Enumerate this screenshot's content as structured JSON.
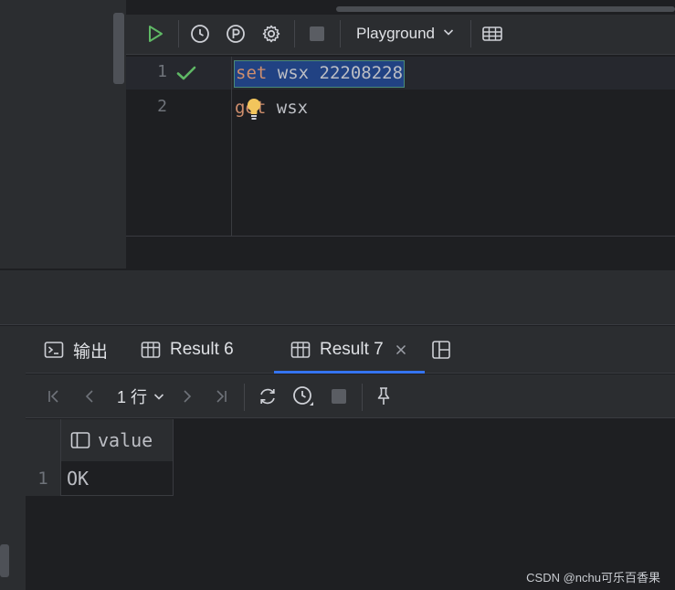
{
  "editor": {
    "toolbar": {
      "icons": [
        "run-icon",
        "history-icon",
        "parameter-icon",
        "settings-icon",
        "stop-icon",
        "table-view-icon"
      ],
      "session_label": "Playground"
    },
    "lines": [
      {
        "number": "1",
        "status": "success-check-icon",
        "tokens": [
          "set",
          " wsx 22208228"
        ]
      },
      {
        "number": "2",
        "tokens": [
          "get",
          " wsx"
        ]
      }
    ]
  },
  "results": {
    "tabs": [
      {
        "label": "输出",
        "icon": "console-icon"
      },
      {
        "label": "Result 6",
        "icon": "table-icon"
      },
      {
        "label": "Result 7",
        "icon": "table-icon",
        "active": true,
        "closable": true
      }
    ],
    "rows_label": "1 行",
    "columns": [
      "value"
    ],
    "rows": [
      {
        "num": "1",
        "cells": [
          "OK"
        ]
      }
    ]
  },
  "watermark": "CSDN @nchu可乐百香果",
  "colors": {
    "accent": "#3574f0",
    "run_green": "#5fb865",
    "keyword": "#cf8e6d",
    "selection": "#214283"
  }
}
